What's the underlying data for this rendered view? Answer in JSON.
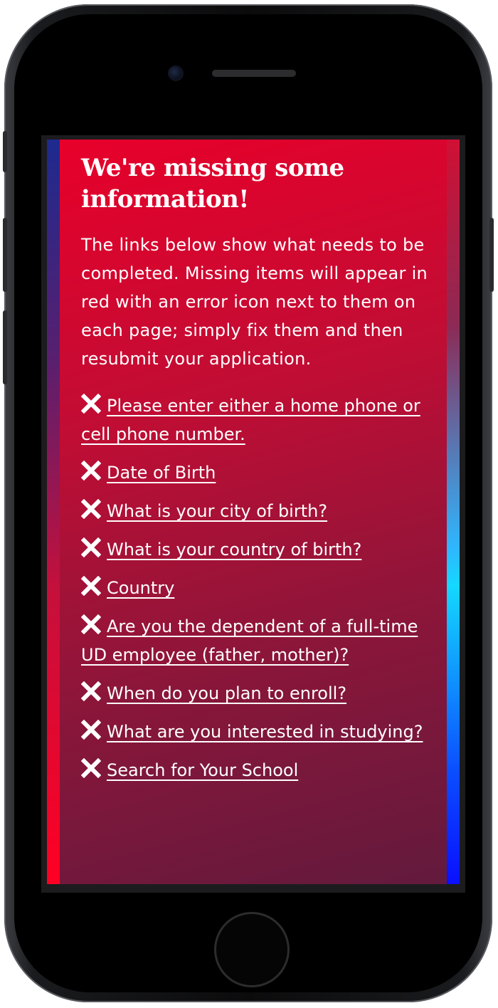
{
  "alert": {
    "title": "We're missing some information!",
    "intro": "The links below show what needs to be completed. Missing items will appear in red with an error icon next to them on each page; simply fix them and then resubmit your application."
  },
  "errors": [
    {
      "label": "Please enter either a home phone or cell phone number."
    },
    {
      "label": "Date of Birth"
    },
    {
      "label": "What is your city of birth?"
    },
    {
      "label": "What is your country of birth?"
    },
    {
      "label": "Country"
    },
    {
      "label": "Are you the dependent of a full-time UD employee (father, mother)?"
    },
    {
      "label": "When do you plan to enroll?"
    },
    {
      "label": "What are you interested in studying?"
    },
    {
      "label": "Search for Your School"
    }
  ],
  "icons": {
    "error_icon": "close-x-icon"
  },
  "colors": {
    "background_start": "#e8002a",
    "background_end": "#621a3d",
    "text": "#ffffff"
  }
}
